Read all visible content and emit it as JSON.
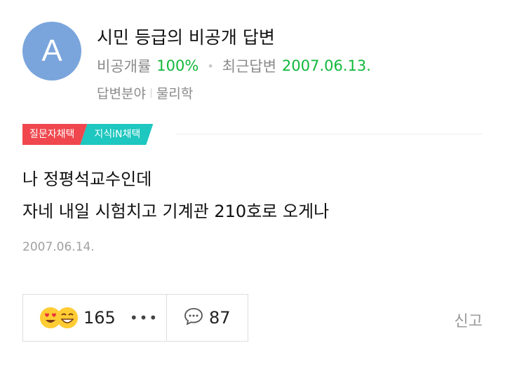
{
  "author": {
    "avatar_letter": "A",
    "title": "시민 등급의 비공개 답변",
    "rate_label": "비공개률",
    "rate_value": "100%",
    "recent_label": "최근답변",
    "recent_value": "2007.06.13.",
    "field_label": "답변분야",
    "field_value": "물리학"
  },
  "badges": {
    "questioner": "질문자채택",
    "kin": "지식iN채택"
  },
  "answer": {
    "line1": "나 정평석교수인데",
    "line2": "자네 내일 시험치고 기계관 210호로 오게나",
    "date": "2007.06.14."
  },
  "actions": {
    "reaction_count": "165",
    "more_label": "•••",
    "comment_count": "87",
    "report_label": "신고"
  },
  "colors": {
    "accent_green": "#11b83b",
    "badge_red": "#f0474e",
    "badge_teal": "#1ec7bf",
    "avatar_blue": "#7aa5dc"
  }
}
